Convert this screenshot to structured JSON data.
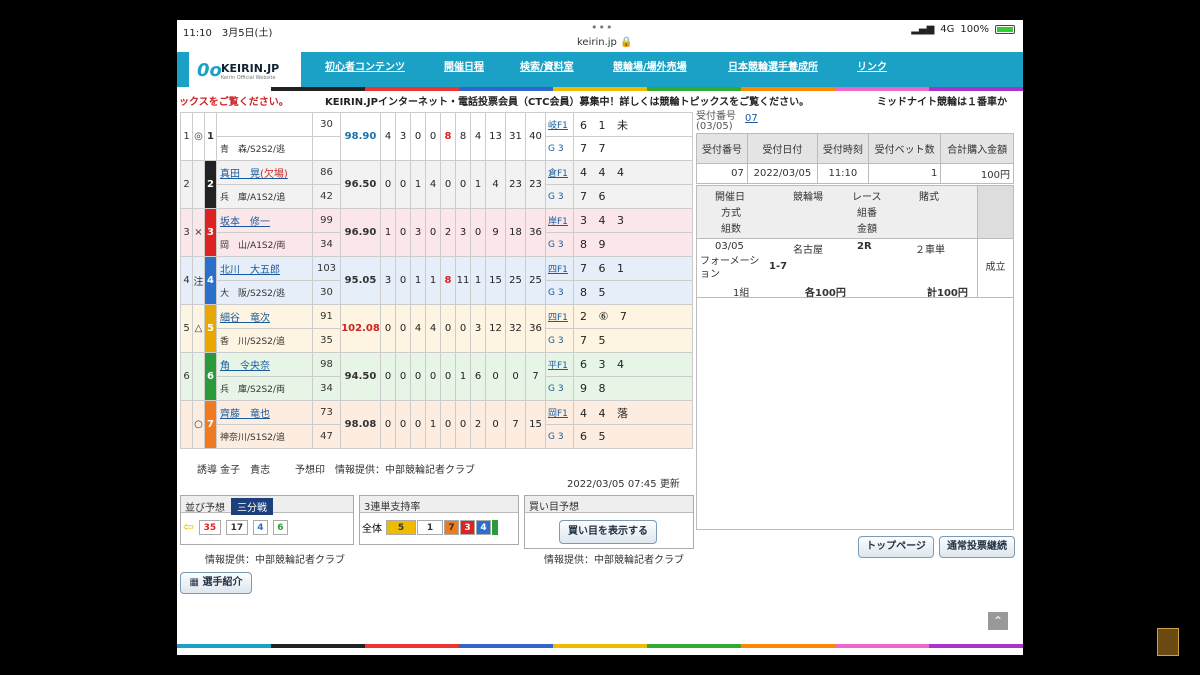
{
  "status": {
    "time": "11:10",
    "date": "3月5日(土)",
    "url": "keirin.jp",
    "network": "4G",
    "battery": "100%"
  },
  "logo": {
    "text": "KEIRIN.JP",
    "sub": "Keirin Official Website"
  },
  "nav": [
    "初心者コンテンツ",
    "開催日程",
    "検索/資料室",
    "競輪場/場外売場",
    "日本競輪選手養成所",
    "リンク"
  ],
  "ticker": {
    "left": "ックスをご覧ください。",
    "main": "KEIRIN.JPインターネット・電話投票会員（CTC会員）募集中！詳しくは競輪トピックスをご覧ください。",
    "right": "ミッドナイト競輪は１番車か"
  },
  "race_rows": [
    {
      "bnum": "1",
      "mark": "◎",
      "num": "1",
      "num_color": "#ffffff",
      "name": "",
      "info": "青　森/S2S2/逃",
      "age1": "30",
      "age2": "",
      "score": "98.90",
      "score_color": "#1a73a8",
      "digits": [
        "4",
        "3",
        "0",
        "0",
        "8",
        "8",
        "4",
        "13",
        "31",
        "40"
      ],
      "red_idx": [
        4
      ],
      "p1": "岐F1",
      "r1": "6 1 未",
      "p2": "G 3",
      "r2": "7 7",
      "bg": "#ffffff",
      "partial": true
    },
    {
      "bnum": "2",
      "mark": "",
      "num": "2",
      "num_color": "#222222",
      "name": "真田　晃",
      "name_suffix": "(欠場)",
      "info": "兵　庫/A1S2/追",
      "age1": "86",
      "age2": "42",
      "score": "96.50",
      "score_color": "#333333",
      "digits": [
        "0",
        "0",
        "1",
        "4",
        "0",
        "0",
        "1",
        "4",
        "23",
        "23"
      ],
      "red_idx": [],
      "p1": "倉F1",
      "r1": "4 4 4",
      "p2": "G 3",
      "r2": "7 6",
      "bg": "#f2f2f2"
    },
    {
      "bnum": "3",
      "mark": "×",
      "num": "3",
      "num_color": "#d22",
      "name": "坂本　修一",
      "info": "岡　山/A1S2/両",
      "age1": "99",
      "age2": "34",
      "score": "96.90",
      "score_color": "#333333",
      "digits": [
        "1",
        "0",
        "3",
        "0",
        "2",
        "3",
        "0",
        "9",
        "18",
        "36"
      ],
      "red_idx": [],
      "p1": "岸F1",
      "r1": "3 4 3",
      "p2": "G 3",
      "r2": "8 9",
      "bg": "#fbe6ea"
    },
    {
      "bnum": "4",
      "mark": "注",
      "num": "4",
      "num_color": "#2a6fc9",
      "name": "北川　大五郎",
      "info": "大　阪/S2S2/逃",
      "age1": "103",
      "age2": "30",
      "score": "95.05",
      "score_color": "#333333",
      "digits": [
        "3",
        "0",
        "1",
        "1",
        "8",
        "11",
        "1",
        "15",
        "25",
        "25"
      ],
      "red_idx": [
        4
      ],
      "p1": "四F1",
      "r1": "7 6 1",
      "p2": "G 3",
      "r2": "8 5",
      "bg": "#e6eef9"
    },
    {
      "bnum": "5",
      "mark": "△",
      "num": "5",
      "num_color": "#e8a800",
      "name": "細谷　竜次",
      "info": "香　川/S2S2/追",
      "age1": "91",
      "age2": "35",
      "score": "102.08",
      "score_color": "#c22",
      "digits": [
        "0",
        "0",
        "4",
        "4",
        "0",
        "0",
        "3",
        "12",
        "32",
        "36"
      ],
      "red_idx": [],
      "p1": "四F1",
      "r1": "2 ⑥ 7",
      "p2": "G 3",
      "r2": "7 5",
      "bg": "#fdf5e1"
    },
    {
      "bnum": "6",
      "mark": "",
      "num": "6",
      "num_color": "#2a9a3a",
      "name": "角　令央奈",
      "info": "兵　庫/S2S2/両",
      "age1": "98",
      "age2": "34",
      "score": "94.50",
      "score_color": "#333333",
      "digits": [
        "0",
        "0",
        "0",
        "0",
        "0",
        "1",
        "6",
        "0",
        "0",
        "7"
      ],
      "red_idx": [],
      "p1": "平F1",
      "r1": "6 3 4",
      "p2": "G 3",
      "r2": "9 8",
      "bg": "#e7f5e7"
    },
    {
      "bnum": "",
      "mark": "○",
      "num": "7",
      "num_color": "#f07a20",
      "name": "齊藤　竜也",
      "info": "神奈川/S1S2/追",
      "age1": "73",
      "age2": "47",
      "score": "98.08",
      "score_color": "#333333",
      "digits": [
        "0",
        "0",
        "0",
        "1",
        "0",
        "0",
        "2",
        "0",
        "7",
        "15"
      ],
      "red_idx": [],
      "p1": "岡F1",
      "r1": "4 4 落",
      "p2": "G 3",
      "r2": "6 5",
      "bg": "#fdece0"
    }
  ],
  "guide": "誘導 金子　貴志",
  "forecast": "予想印　情報提供：中部競輪記者クラブ",
  "updated": "2022/03/05 07:45 更新",
  "narabi": {
    "title": "並び予想",
    "tag": "三分戦",
    "groups": [
      "35",
      "17",
      "4",
      "6"
    ],
    "credit": "情報提供：中部競輪記者クラブ"
  },
  "support": {
    "title": "3連単支持率",
    "label": "全体",
    "values": [
      "5",
      "1",
      "7",
      "3",
      "4"
    ]
  },
  "kaime": {
    "title": "買い目予想",
    "button": "買い目を表示する",
    "credit": "情報提供：中部競輪記者クラブ"
  },
  "intro_button": "選手紹介",
  "receipt": {
    "top_label": "受付番号",
    "top_value": "07",
    "top_date": "(03/05)",
    "headers": [
      "受付番号",
      "受付日付",
      "受付時刻",
      "受付ベット数",
      "合計購入金額"
    ],
    "row": [
      "07",
      "2022/03/05",
      "11:10",
      "1",
      "100円"
    ],
    "detail_headers": [
      "開催日",
      "競輪場",
      "レース",
      "賭式",
      "方式",
      "組番",
      "組数",
      "金額"
    ],
    "detail": {
      "date": "03/05",
      "venue": "名古屋",
      "race": "2R",
      "bet": "２車単",
      "method": "フォーメーション",
      "combo": "1-7",
      "count": "1組",
      "each": "各100円",
      "total": "計100円",
      "status": "成立"
    }
  },
  "buttons": {
    "top": "トップページ",
    "continue": "通常投票継続"
  }
}
